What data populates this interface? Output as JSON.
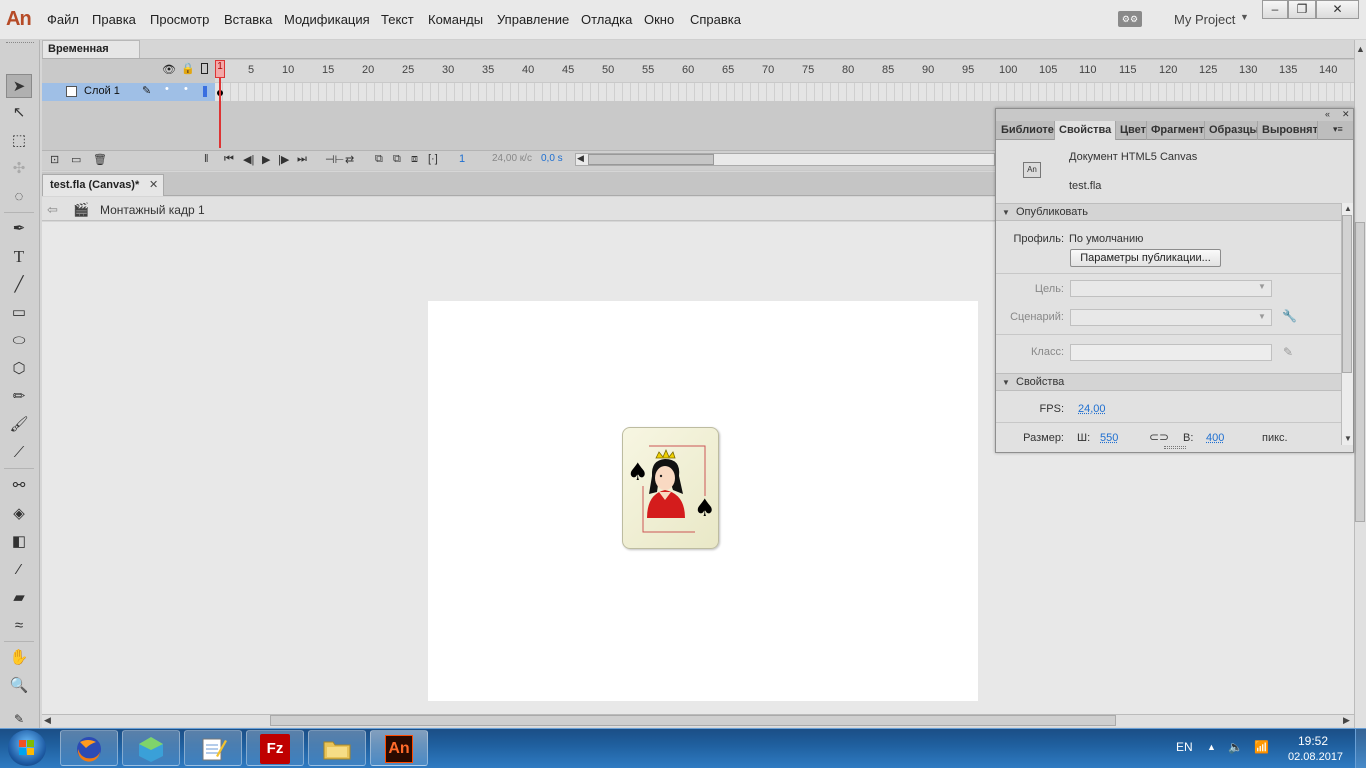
{
  "app": {
    "logo": "An",
    "project": "My Project"
  },
  "menu": [
    "Файл",
    "Правка",
    "Просмотр",
    "Вставка",
    "Модификация",
    "Текст",
    "Команды",
    "Управление",
    "Отладка",
    "Окно",
    "Справка"
  ],
  "window_controls": {
    "min": "‒",
    "max": "❐",
    "close": "✕"
  },
  "timeline": {
    "tab_label": "Временная шкала",
    "ruler": [
      "1",
      "5",
      "10",
      "15",
      "20",
      "25",
      "30",
      "35",
      "40",
      "45",
      "50",
      "55",
      "60",
      "65",
      "70",
      "75",
      "80",
      "85",
      "90",
      "95",
      "100",
      "105",
      "110",
      "115",
      "120",
      "125",
      "130",
      "135",
      "140"
    ],
    "layer_name": "Слой 1",
    "current_frame": "1",
    "fps": "24,00 к/с",
    "time": "0,0 s"
  },
  "document": {
    "tab": "test.fla (Canvas)*",
    "close": "✕",
    "scene": "Монтажный кадр 1"
  },
  "properties": {
    "tabs": [
      "Библиотек",
      "Свойства",
      "Цвет",
      "Фрагменты",
      "Образцы",
      "Выровнять"
    ],
    "doc_type": "Документ HTML5 Canvas",
    "doc_icon": "An",
    "file_name": "test.fla",
    "publish": {
      "section": "Опубликовать",
      "profile_label": "Профиль:",
      "profile_value": "По умолчанию",
      "publish_button": "Параметры публикации...",
      "target_label": "Цель:",
      "script_label": "Сценарий:",
      "class_label": "Класс:"
    },
    "props_section": {
      "section": "Свойства",
      "fps_label": "FPS:",
      "fps_value": "24,00",
      "size_label": "Размер:",
      "w_label": "Ш:",
      "w_value": "550",
      "h_label": "В:",
      "h_value": "400",
      "unit": "пикс."
    }
  },
  "taskbar": {
    "apps": [
      "firefox-icon",
      "app-icon",
      "notepad-icon",
      "filezilla-icon",
      "explorer-icon",
      "animate-icon"
    ],
    "filezilla": "Fz",
    "animate": "An",
    "lang": "EN",
    "time": "19:52",
    "date": "02.08.2017"
  },
  "colors": {
    "accent": "#1e6fd1",
    "animate_brand": "#b64b27",
    "playhead": "#d33333"
  }
}
